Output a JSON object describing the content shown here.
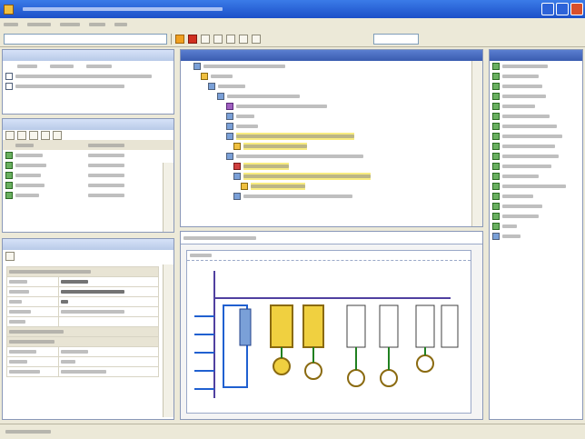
{
  "window": {
    "title": ""
  },
  "menu": {
    "items": [
      "",
      "",
      "",
      "",
      ""
    ]
  },
  "left_top_panel": {
    "title": ""
  },
  "left_mid_panel": {
    "title": ""
  },
  "left_bottom_panel": {
    "title": ""
  },
  "tree_panel": {
    "title": ""
  },
  "diagram_panel": {
    "tab": "",
    "section": ""
  },
  "right_panel": {
    "title": ""
  },
  "statusbar": {
    "text": ""
  }
}
